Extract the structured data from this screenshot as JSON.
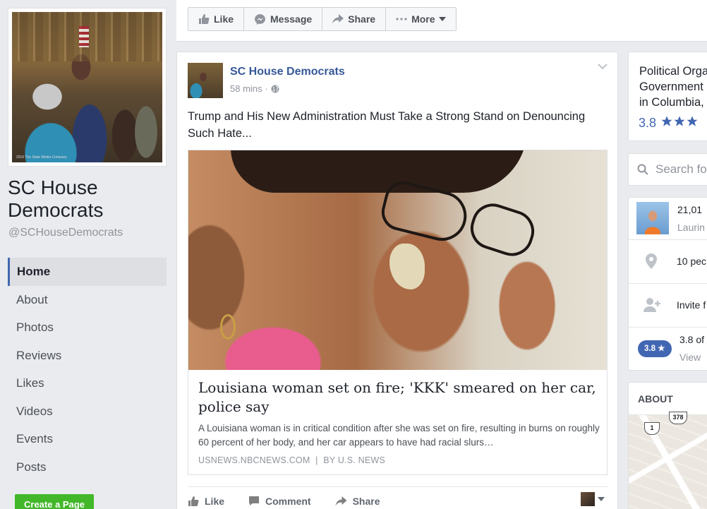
{
  "page": {
    "name": "SC House Democrats",
    "handle": "@SCHouseDemocrats",
    "photo_credit": "2016 The State Media Company"
  },
  "left_nav": {
    "items": [
      {
        "label": "Home",
        "active": true
      },
      {
        "label": "About"
      },
      {
        "label": "Photos"
      },
      {
        "label": "Reviews"
      },
      {
        "label": "Likes"
      },
      {
        "label": "Videos"
      },
      {
        "label": "Events"
      },
      {
        "label": "Posts"
      }
    ],
    "create_page_label": "Create a Page"
  },
  "action_bar": {
    "like_label": "Like",
    "message_label": "Message",
    "share_label": "Share",
    "more_label": "More"
  },
  "post": {
    "author": "SC House Democrats",
    "time": "58 mins",
    "separator": "·",
    "text": "Trump and His New Administration Must Take a Strong Stand on Denouncing Such Hate...",
    "link": {
      "title": "Louisiana woman set on fire; 'KKK' smeared on her car, police say",
      "description": "A Louisiana woman is in critical condition after she was set on fire, resulting in burns on roughly 60 percent of her body, and her car appears to have had racial slurs…",
      "source": "USNEWS.NBCNEWS.COM",
      "byline": "BY U.S. NEWS",
      "source_sep": "|"
    },
    "actions": {
      "like_label": "Like",
      "comment_label": "Comment",
      "share_label": "Share"
    }
  },
  "right_col": {
    "category": [
      "Political Orga",
      "Government",
      "in Columbia,"
    ],
    "rating_value": "3.8",
    "search_placeholder": "Search fo",
    "stats": {
      "likes_count": "21,01",
      "likes_sub": "Laurin",
      "checkins": "10 pec",
      "invite": "Invite f",
      "rating_badge": "3.8 ★",
      "rating_text": "3.8 of",
      "rating_sub": "View"
    },
    "about_header": "ABOUT",
    "map_shields": [
      "1",
      "378"
    ]
  },
  "colors": {
    "link_blue": "#365899",
    "brand_blue": "#4267b2",
    "green_button": "#42b72a",
    "background": "#e9ebee"
  }
}
